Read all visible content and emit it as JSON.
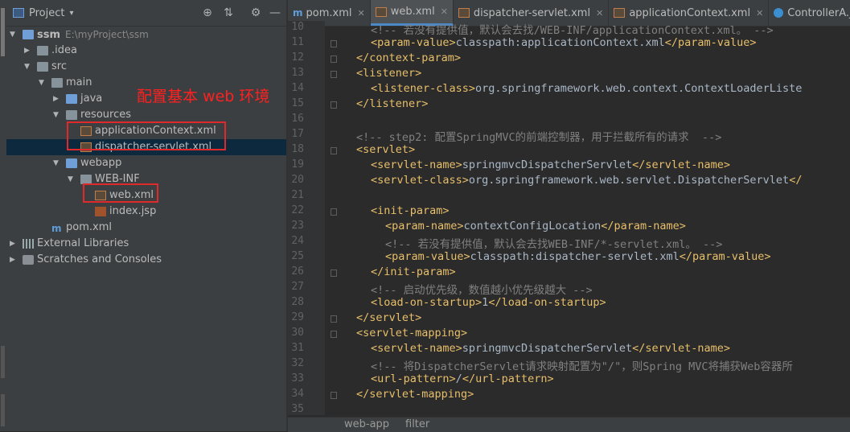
{
  "project_panel": {
    "title": "Project",
    "dropdown_glyph": "▾",
    "toolbar": [
      {
        "name": "locate-icon",
        "glyph": "⊕"
      },
      {
        "name": "collapse-icon",
        "glyph": "⇅"
      },
      {
        "name": "gear-icon",
        "glyph": "⚙"
      },
      {
        "name": "hide-icon",
        "glyph": "—"
      }
    ],
    "tree": [
      {
        "label": "ssm",
        "sub": "E:\\myProject\\ssm",
        "arrow": "▼",
        "icon": "folder-blue",
        "bold": true
      },
      {
        "label": ".idea",
        "arrow": "▶",
        "icon": "folder"
      },
      {
        "label": "src",
        "arrow": "▼",
        "icon": "folder"
      },
      {
        "label": "main",
        "arrow": "▼",
        "icon": "folder"
      },
      {
        "label": "java",
        "arrow": "▶",
        "icon": "folder-blue"
      },
      {
        "label": "resources",
        "arrow": "▼",
        "icon": "folder"
      },
      {
        "label": "applicationContext.xml",
        "arrow": "",
        "icon": "xml"
      },
      {
        "label": "dispatcher-servlet.xml",
        "arrow": "",
        "icon": "xml",
        "selected": true
      },
      {
        "label": "webapp",
        "arrow": "▼",
        "icon": "folder-blue"
      },
      {
        "label": "WEB-INF",
        "arrow": "▼",
        "icon": "folder"
      },
      {
        "label": "web.xml",
        "arrow": "",
        "icon": "xml"
      },
      {
        "label": "index.jsp",
        "arrow": "",
        "icon": "jsp"
      },
      {
        "label": "pom.xml",
        "arrow": "",
        "icon": "maven"
      },
      {
        "label": "External Libraries",
        "arrow": "▶",
        "icon": "library"
      },
      {
        "label": "Scratches and Consoles",
        "arrow": "▶",
        "icon": "scratch"
      }
    ],
    "annotation": "配置基本 web 环境"
  },
  "tabs": [
    {
      "label": "pom.xml",
      "icon": "maven",
      "active": false
    },
    {
      "label": "web.xml",
      "icon": "xml",
      "active": true
    },
    {
      "label": "dispatcher-servlet.xml",
      "icon": "xml",
      "active": false
    },
    {
      "label": "applicationContext.xml",
      "icon": "xml",
      "active": false
    },
    {
      "label": "ControllerA.java",
      "icon": "class",
      "active": false
    }
  ],
  "code_lines": [
    {
      "n": "10",
      "indent": 1,
      "type": "comment",
      "text": "<!-- 若没有提供值，默认会去找/WEB-INF/applicationContext.xml。 -->"
    },
    {
      "n": "11",
      "indent": 1,
      "type": "element",
      "open": "<param-value>",
      "text": "classpath:applicationContext.xml",
      "close": "</param-value>"
    },
    {
      "n": "12",
      "indent": 0,
      "type": "tag",
      "text": "</context-param>"
    },
    {
      "n": "13",
      "indent": 0,
      "type": "tag",
      "text": "<listener>"
    },
    {
      "n": "14",
      "indent": 1,
      "type": "element",
      "open": "<listener-class>",
      "text": "org.springframework.web.context.ContextLoaderListe",
      "close": ""
    },
    {
      "n": "15",
      "indent": 0,
      "type": "tag",
      "text": "</listener>"
    },
    {
      "n": "16",
      "indent": 0,
      "type": "blank",
      "text": ""
    },
    {
      "n": "17",
      "indent": 0,
      "type": "comment",
      "text": "<!-- step2: 配置SpringMVC的前端控制器，用于拦截所有的请求  -->"
    },
    {
      "n": "18",
      "indent": 0,
      "type": "tag",
      "text": "<servlet>"
    },
    {
      "n": "19",
      "indent": 1,
      "type": "element",
      "open": "<servlet-name>",
      "text": "springmvcDispatcherServlet",
      "close": "</servlet-name>"
    },
    {
      "n": "20",
      "indent": 1,
      "type": "element",
      "open": "<servlet-class>",
      "text": "org.springframework.web.servlet.DispatcherServlet",
      "close": "</"
    },
    {
      "n": "21",
      "indent": 0,
      "type": "blank",
      "text": ""
    },
    {
      "n": "22",
      "indent": 1,
      "type": "tag",
      "text": "<init-param>"
    },
    {
      "n": "23",
      "indent": 2,
      "type": "element",
      "open": "<param-name>",
      "text": "contextConfigLocation",
      "close": "</param-name>"
    },
    {
      "n": "24",
      "indent": 2,
      "type": "comment",
      "text": "<!-- 若没有提供值，默认会去找WEB-INF/*-servlet.xml。 -->"
    },
    {
      "n": "25",
      "indent": 2,
      "type": "element",
      "open": "<param-value>",
      "text": "classpath:dispatcher-servlet.xml",
      "close": "</param-value>"
    },
    {
      "n": "26",
      "indent": 1,
      "type": "tag",
      "text": "</init-param>"
    },
    {
      "n": "27",
      "indent": 1,
      "type": "comment",
      "text": "<!-- 启动优先级，数值越小优先级越大 -->"
    },
    {
      "n": "28",
      "indent": 1,
      "type": "element",
      "open": "<load-on-startup>",
      "text": "1",
      "close": "</load-on-startup>"
    },
    {
      "n": "29",
      "indent": 0,
      "type": "tag",
      "text": "</servlet>"
    },
    {
      "n": "30",
      "indent": 0,
      "type": "tag",
      "text": "<servlet-mapping>"
    },
    {
      "n": "31",
      "indent": 1,
      "type": "element",
      "open": "<servlet-name>",
      "text": "springmvcDispatcherServlet",
      "close": "</servlet-name>"
    },
    {
      "n": "32",
      "indent": 1,
      "type": "comment",
      "text": "<!-- 将DispatcherServlet请求映射配置为\"/\"，则Spring MVC将捕获Web容器所"
    },
    {
      "n": "33",
      "indent": 1,
      "type": "element",
      "open": "<url-pattern>",
      "text": "/",
      "close": "</url-pattern>"
    },
    {
      "n": "34",
      "indent": 0,
      "type": "tag",
      "text": "</servlet-mapping>"
    },
    {
      "n": "35",
      "indent": 0,
      "type": "blank",
      "text": ""
    }
  ],
  "breadcrumb": [
    "web-app",
    "filter"
  ]
}
